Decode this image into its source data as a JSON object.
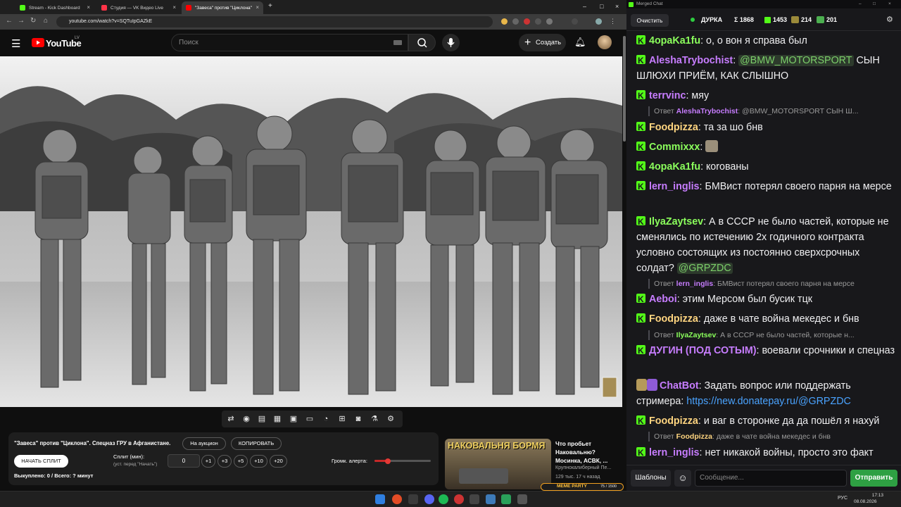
{
  "browser": {
    "tabs": [
      {
        "title": "Stream - Kick Dashboard",
        "color": "#53fc18"
      },
      {
        "title": "Студия — VK Видео Live",
        "color": "#ff3347"
      },
      {
        "title": "\"Завеса\" против \"Циклона\"",
        "color": "#ff0000"
      }
    ],
    "url": "youtube.com/watch?v=SQTuIpGAZkE",
    "new_tab": "+"
  },
  "youtube": {
    "logo": "YouTube",
    "region": "LV",
    "search_placeholder": "Поиск",
    "create_label": "Создать"
  },
  "extension_panel": {
    "video_title": "\"Завеса\" против \"Циклона\". Спецназ ГРУ в Афганистане.",
    "auction_button": "На аукцион",
    "copy_button": "КОПИРОВАТЬ",
    "start_split_button": "НАЧАТЬ СПЛИТ",
    "split_label": "Сплит (мин):",
    "split_hint": "(уст. перед \"Начать\")",
    "split_value": "0",
    "increments": [
      "+1",
      "+3",
      "+5",
      "+10",
      "+20"
    ],
    "alert_volume_label": "Громк. алерта:",
    "alert_volume": 0.2,
    "bought_text": "Выкуплено: 0 / Всего: ? минут"
  },
  "recommendation": {
    "thumb_text": "НАКОВАЛЬНЯ БОРМЯ",
    "title": "Что пробьет Наковальню? Мосинка, АСВК, ...",
    "channel": "Крупнокалиберный Пе...",
    "stats": "129 тыс.  17 ч назад",
    "overlay_text": "MEME PARTY",
    "overlay_count": "75 / 1500"
  },
  "chat": {
    "window_title": "Merged Chat",
    "clear_button": "Очистить",
    "channel": "ДУРКА",
    "total": "Σ 1868",
    "kick_count": "1453",
    "vk_count": "214",
    "other_count": "201",
    "messages": [
      {
        "user": "4opaKa1fu",
        "color": "#8bff5c",
        "text": ": о, о вон я справа был"
      },
      {
        "user": "AleshaTrybochist",
        "color": "#c77dff",
        "mention": "@BMW_MOTORSPORT",
        "text": " СЫН ШЛЮХИ ПРИЁМ, КАК СЛЫШНО"
      },
      {
        "user": "terrvinc",
        "color": "#c77dff",
        "text": ": мяу"
      },
      {
        "user": "Foodpizza",
        "color": "#ffd580",
        "text": ": та за шо бнв"
      },
      {
        "user": "Commixxx",
        "color": "#8bff5c",
        "text": ":"
      },
      {
        "user": "4opaKa1fu",
        "color": "#8bff5c",
        "text": ": кorованы"
      },
      {
        "user": "lern_inglis",
        "color": "#c77dff",
        "text": ": БМВист потерял своего парня на мерсе"
      },
      {
        "user": "IlyaZaytsev",
        "color": "#8bff5c",
        "text": ": А в СССР не было частей, которые не сменялись по истечению 2х годичного контракта условно состоящих из постоянно сверхсрочных солдат?",
        "mention": "@GRPZDC"
      },
      {
        "user": "Aeboi",
        "color": "#c77dff",
        "text": ": этим Мерсом был бусик тцк"
      },
      {
        "user": "Foodpizza",
        "color": "#ffd580",
        "text": ": даже в чате война мекедес и бнв"
      },
      {
        "user": "ДУГИН (ПОД СОТЫМ)",
        "color": "#c77dff",
        "text": ": воевали срочники и спецназ"
      },
      {
        "user": "ChatBot",
        "color": "#c77dff",
        "text": ": Задать вопрос или поддержать стримера: ",
        "link": "https://new.donatepay.ru/@GRPZDC"
      },
      {
        "user": "Foodpizza",
        "color": "#ffd580",
        "text": ": и ваг в сторонке да да пошёл я нахуй"
      },
      {
        "user": "lern_inglis",
        "color": "#c77dff",
        "text": ": нет никакой войны, просто это факт"
      }
    ],
    "replies": [
      {
        "prefix": "Ответ",
        "user": "AleshaTrybochist",
        "color": "#c77dff",
        "text": ": @BMW_MOTORSPORT СЫН Ш..."
      },
      {
        "prefix": "Ответ",
        "user": "lern_inglis",
        "color": "#c77dff",
        "text": ": БМВист потерял своего парня на мерсе"
      },
      {
        "prefix": "Ответ",
        "user": "IlyaZaytsev",
        "color": "#8bff5c",
        "text": ": А в СССР не было частей, которые н..."
      },
      {
        "prefix": "Ответ",
        "user": "Foodpizza",
        "color": "#ffd580",
        "text": ": даже в чате война мекедес и бнв"
      }
    ],
    "templates_button": "Шаблоны",
    "message_placeholder": "Сообщение...",
    "send_button": "Отправить"
  },
  "taskbar": {
    "lang": "РУС",
    "time": "17:13",
    "date": "08.08.2026"
  },
  "colors": {
    "kick": "#53fc18",
    "accent_green": "#2ea043"
  }
}
